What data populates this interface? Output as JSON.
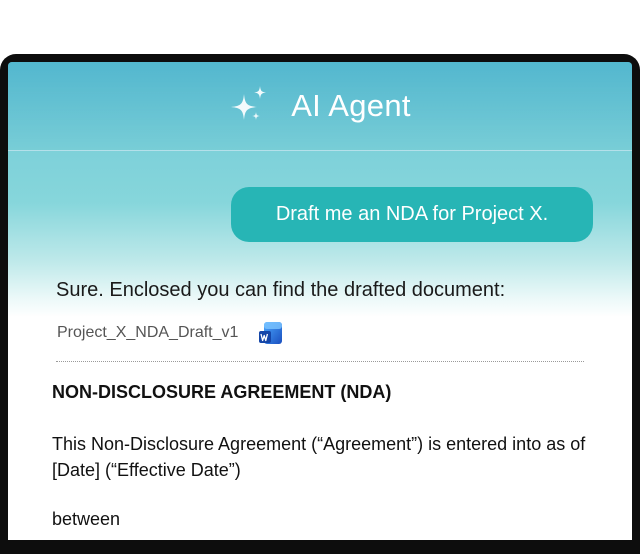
{
  "header": {
    "title": "AI Agent",
    "icon": "sparkle-icon"
  },
  "chat": {
    "user_message": "Draft me an NDA for Project X.",
    "agent_reply": "Sure. Enclosed you can find the drafted document:",
    "attachment": {
      "file_name": "Project_X_NDA_Draft_v1",
      "icon": "word-document-icon"
    }
  },
  "document": {
    "title": "NON-DISCLOSURE AGREEMENT (NDA)",
    "paragraph": "This Non-Disclosure Agreement (“Agreement”) is entered into as of [Date] (“Effective Date”)",
    "between": "between"
  },
  "colors": {
    "header_gradient_top": "#6fc7d6",
    "user_bubble": "#27b5b5",
    "word_blue": "#2b6fd6"
  }
}
